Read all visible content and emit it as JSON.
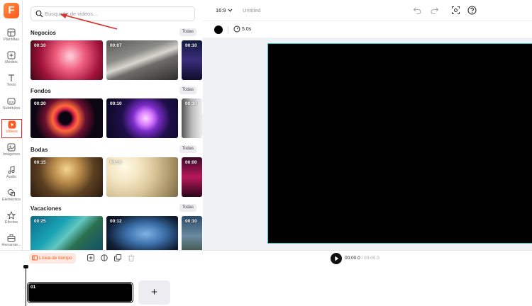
{
  "rail": {
    "items": [
      {
        "label": "Plantillas",
        "icon": "templates-icon"
      },
      {
        "label": "Medios",
        "icon": "media-upload-icon"
      },
      {
        "label": "Texto",
        "icon": "text-icon"
      },
      {
        "label": "Subtítulos",
        "icon": "subtitles-icon"
      },
      {
        "label": "Videos",
        "icon": "video-play-icon",
        "active": true
      },
      {
        "label": "Imágenes",
        "icon": "image-icon"
      },
      {
        "label": "Audio",
        "icon": "music-note-icon"
      },
      {
        "label": "Elementos",
        "icon": "shapes-icon"
      },
      {
        "label": "Efectos",
        "icon": "effects-icon"
      },
      {
        "label": "Herramie...",
        "icon": "toolbox-icon"
      }
    ]
  },
  "search": {
    "placeholder": "Búsqueda de videos..."
  },
  "sections": [
    {
      "title": "Negocios",
      "all": "Todas",
      "durations": [
        "00:10",
        "00:07",
        "00:10"
      ]
    },
    {
      "title": "Fondos",
      "all": "Todas",
      "durations": [
        "00:30",
        "00:10",
        "00:10"
      ]
    },
    {
      "title": "Bodas",
      "all": "Todas",
      "durations": [
        "00:15",
        "00:10",
        "00:00"
      ]
    },
    {
      "title": "Vacaciones",
      "all": "Todas",
      "durations": [
        "00:25",
        "00:12",
        "00:10"
      ]
    }
  ],
  "topbar": {
    "ratio": "16:9",
    "title": "Untitled"
  },
  "props": {
    "duration": "5.0s",
    "color": "#000000"
  },
  "timeline": {
    "button": "Línea de tiempo",
    "current": "00:00.0",
    "separator": "/",
    "total": "00:05.0",
    "clip_number": "01",
    "add": "+"
  },
  "colors": {
    "accent": "#ff5a1f",
    "canvas_border": "#3fc9c9"
  }
}
